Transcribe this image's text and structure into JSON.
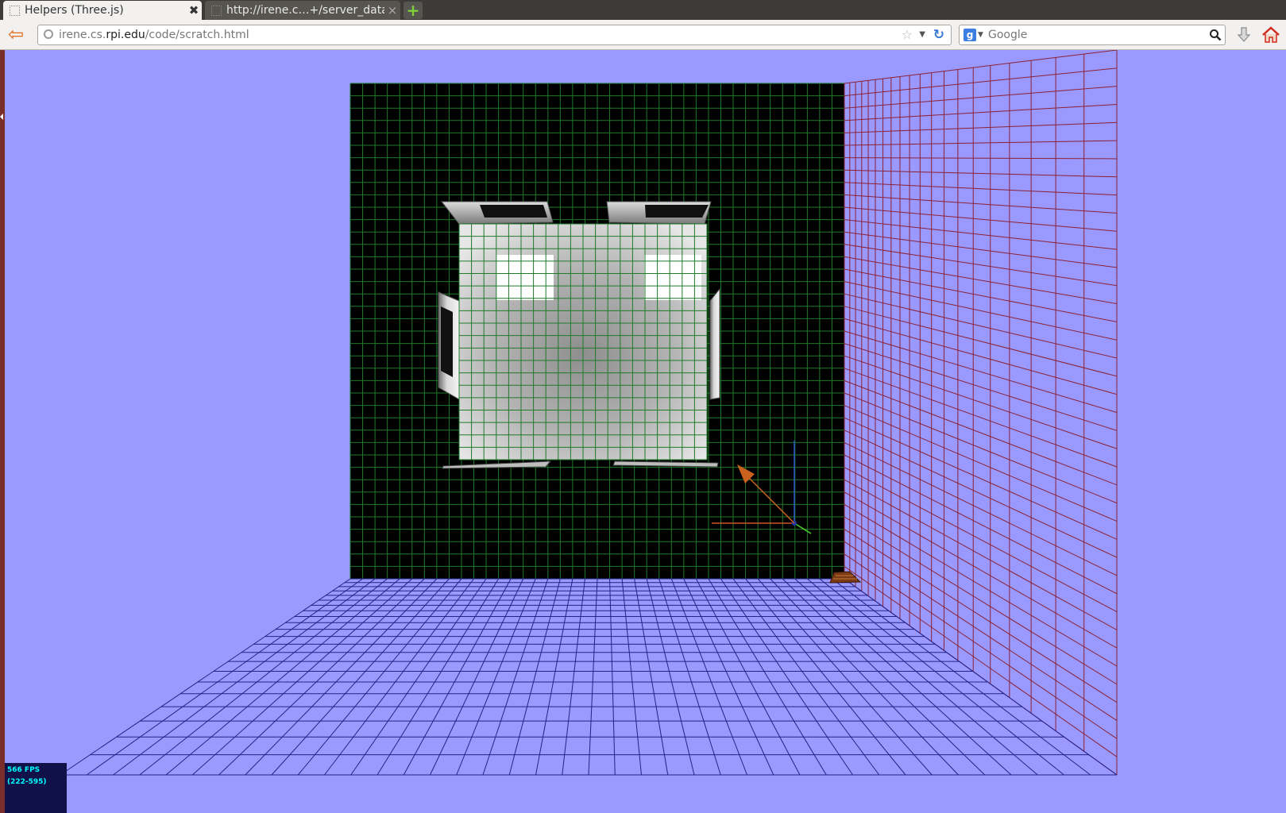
{
  "browser": {
    "tabs": [
      {
        "title": "Helpers (Three.js)",
        "active": true,
        "close_glyph": "✖"
      },
      {
        "title": "http://irene.c…+/server_data",
        "active": false,
        "close_glyph": "×"
      }
    ],
    "new_tab_glyph": "+",
    "url": {
      "host_prefix": "irene.cs.",
      "host_domain": "rpi.edu",
      "path": "/code/scratch.html"
    },
    "search": {
      "engine_glyph": "g",
      "placeholder": "Google"
    }
  },
  "scene": {
    "background_color": "#9999ff",
    "back_wall_color": "#000000",
    "back_grid_color": "#1f7a2a",
    "side_grid_color": "#8b2235",
    "floor_grid_color": "#222288",
    "arrow_color": "#c8621e",
    "axis_colors": {
      "x": "#d0542a",
      "y": "#2e56c8",
      "z": "#4fd22e"
    }
  },
  "stats": {
    "fps": "566 FPS",
    "range": "(222-595)"
  }
}
